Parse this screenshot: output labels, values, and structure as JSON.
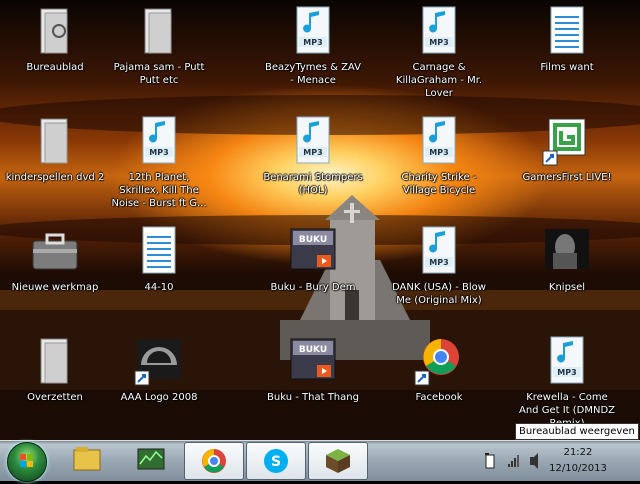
{
  "desktop": {
    "icons": [
      {
        "label": "Bureaublad",
        "type": "folder-shortcut"
      },
      {
        "label": "Pajama sam - Putt Putt etc",
        "type": "folder"
      },
      {
        "label": "BeazyTymes & ZAV - Menace",
        "type": "mp3"
      },
      {
        "label": "Carnage & KillaGraham - Mr. Lover",
        "type": "mp3"
      },
      {
        "label": "Films want",
        "type": "text"
      },
      {
        "label": "kinderspellen dvd 2",
        "type": "folder"
      },
      {
        "label": "12th Planet, Skrillex, Kill The Noise - Burst ft G...",
        "type": "mp3"
      },
      {
        "label": "Benarami Stompers (HOL)",
        "type": "mp3"
      },
      {
        "label": "Charity Strike - Village Bicycle",
        "type": "mp3"
      },
      {
        "label": "GamersFirst LIVE!",
        "type": "gamersfirst"
      },
      {
        "label": "Nieuwe werkmap",
        "type": "briefcase"
      },
      {
        "label": "44-10",
        "type": "text"
      },
      {
        "label": "Buku - Bury Dem",
        "type": "video"
      },
      {
        "label": "DANK (USA) - Blow Me (Original Mix)",
        "type": "mp3"
      },
      {
        "label": "Knipsel",
        "type": "snip"
      },
      {
        "label": "Overzetten",
        "type": "folder"
      },
      {
        "label": "AAA Logo 2008",
        "type": "aaa-logo"
      },
      {
        "label": "Buku - That Thang",
        "type": "video"
      },
      {
        "label": "Facebook",
        "type": "chrome"
      },
      {
        "label": "Krewella - Come And Get It (DMNDZ Remix)",
        "type": "mp3"
      }
    ]
  },
  "taskbar": {
    "pinned": [
      {
        "name": "explorer"
      },
      {
        "name": "task-manager"
      },
      {
        "name": "chrome"
      },
      {
        "name": "skype"
      },
      {
        "name": "minecraft"
      }
    ],
    "clock": {
      "time": "21:22",
      "date": "12/10/2013"
    },
    "show_desktop_tooltip": "Bureaublad weergeven"
  },
  "colors": {
    "text": "#ffffff",
    "mp3_icon": "#1a9fd8",
    "taskbar": "#9aa8b3",
    "sky_glow": "#ffd060"
  }
}
